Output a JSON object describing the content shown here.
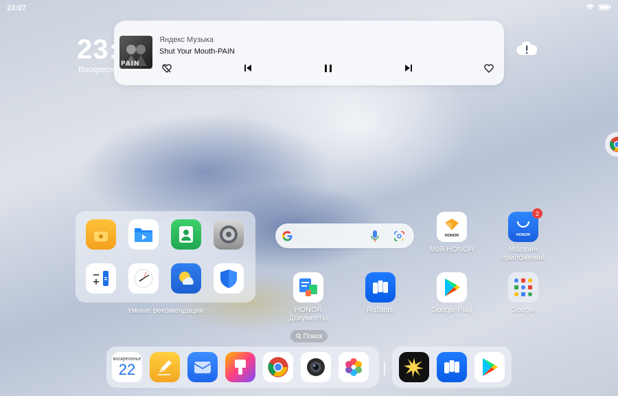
{
  "status_bar": {
    "time": "23:07"
  },
  "lockscreen_clock": {
    "time": "23:",
    "date": "Воскресе"
  },
  "music_widget": {
    "app_name": "Яндекс Музыка",
    "track": "Shut Your Mouth-PAIN",
    "album_text": "PAIN"
  },
  "folder": {
    "label": "Умные рекомендации"
  },
  "calendar_widget": {
    "weekday": "воскресенье",
    "day": "22"
  },
  "apps": {
    "my_honor": {
      "label": "Мой HONOR",
      "brand": "HONOR"
    },
    "app_market": {
      "label": "Магазин приложений",
      "brand": "HONOR",
      "badge": "2"
    },
    "honor_docs": {
      "label": "HONOR Документы"
    },
    "rustore": {
      "label": "RuStore"
    },
    "google_play": {
      "label": "Google Play"
    },
    "google": {
      "label": "Google"
    }
  },
  "search_pill": {
    "label": "Поиск"
  },
  "colors": {
    "accent_blue": "#1e6fe8",
    "badge_red": "#e8413c",
    "honor_orange": "#f6a623"
  }
}
